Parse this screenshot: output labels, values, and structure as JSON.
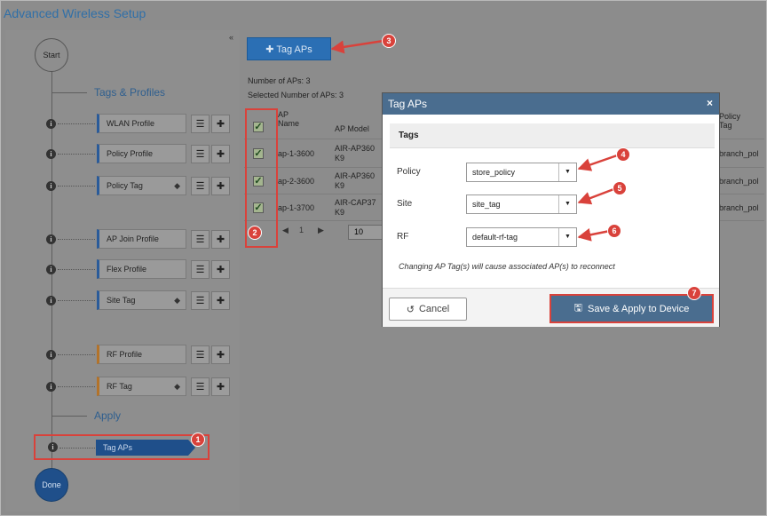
{
  "page": {
    "title": "Advanced Wireless Setup",
    "collapse_icon": "double-chevron-left-icon"
  },
  "wizard": {
    "start_label": "Start",
    "done_label": "Done",
    "sections": {
      "tags_profiles": "Tags & Profiles",
      "apply": "Apply"
    },
    "items": {
      "wlan_profile": "WLAN Profile",
      "policy_profile": "Policy Profile",
      "policy_tag": "Policy Tag",
      "ap_join_profile": "AP Join Profile",
      "flex_profile": "Flex Profile",
      "site_tag": "Site Tag",
      "rf_profile": "RF Profile",
      "rf_tag": "RF Tag",
      "tag_aps": "Tag APs"
    },
    "info_glyph": "i",
    "list_glyph": "☰",
    "add_glyph": "✚",
    "tag_glyph": "◆"
  },
  "main": {
    "tag_aps_button": "✚ Tag APs",
    "num_aps": "Number of APs: 3",
    "selected_aps": "Selected Number of APs: 3",
    "table": {
      "headers": {
        "ap_name": "AP Name",
        "ap_model": "AP Model",
        "policy_tag": "Policy Tag"
      },
      "rows": [
        {
          "ap_name": "ap-1-3600",
          "ap_model": "AIR-AP360 K9",
          "policy_tag": "branch_pol"
        },
        {
          "ap_name": "ap-2-3600",
          "ap_model": "AIR-AP360 K9",
          "policy_tag": "branch_pol"
        },
        {
          "ap_name": "ap-1-3700",
          "ap_model": "AIR-CAP37 K9",
          "policy_tag": "branch_pol"
        }
      ],
      "check_glyph": "✓"
    },
    "pager": {
      "prev": "◀",
      "page": "1",
      "next": "▶",
      "page_size": "10"
    }
  },
  "modal": {
    "title": "Tag APs",
    "close_glyph": "×",
    "section": "Tags",
    "fields": {
      "policy": {
        "label": "Policy",
        "value": "store_policy"
      },
      "site": {
        "label": "Site",
        "value": "site_tag"
      },
      "rf": {
        "label": "RF",
        "value": "default-rf-tag"
      }
    },
    "caret_glyph": "▼",
    "warning": "Changing AP Tag(s) will cause associated AP(s) to reconnect",
    "cancel": "Cancel",
    "cancel_glyph": "↺",
    "save": "Save & Apply to Device",
    "save_glyph": "🖫"
  },
  "annotations": {
    "badges": [
      "1",
      "2",
      "3",
      "4",
      "5",
      "6",
      "7"
    ],
    "color": "#d9423b"
  }
}
